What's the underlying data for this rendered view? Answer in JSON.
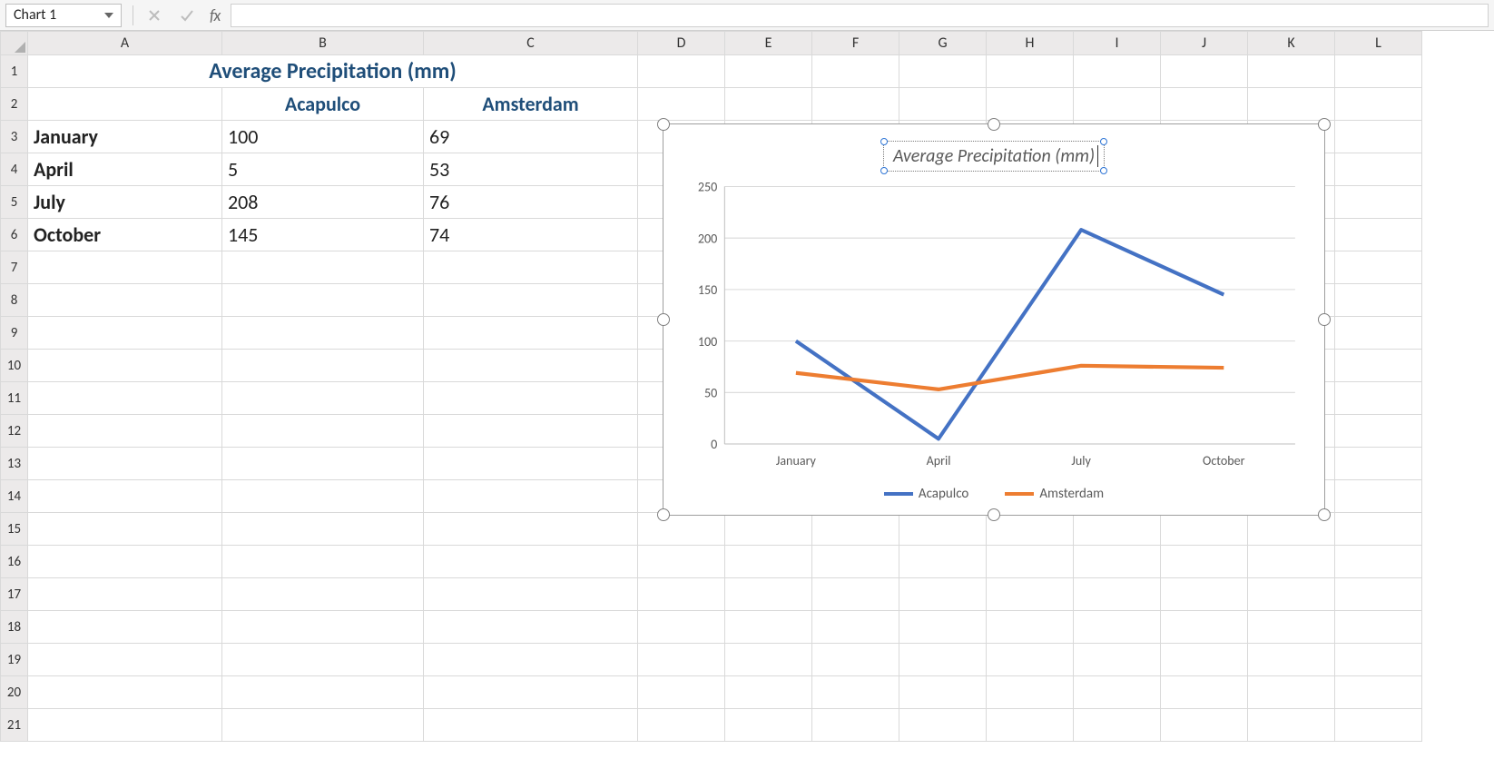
{
  "name_box": {
    "value": "Chart 1"
  },
  "formula_bar": {
    "fx_label": "fx",
    "value": ""
  },
  "columns": [
    "A",
    "B",
    "C",
    "D",
    "E",
    "F",
    "G",
    "H",
    "I",
    "J",
    "K",
    "L"
  ],
  "rows": [
    "1",
    "2",
    "3",
    "4",
    "5",
    "6",
    "7",
    "8",
    "9",
    "10",
    "11",
    "12",
    "13",
    "14",
    "15",
    "16",
    "17",
    "18",
    "19",
    "20",
    "21"
  ],
  "table": {
    "title": "Average Precipitation (mm)",
    "headers": {
      "b": "Acapulco",
      "c": "Amsterdam"
    },
    "data": [
      {
        "month": "January",
        "b": "100",
        "c": "69"
      },
      {
        "month": "April",
        "b": "5",
        "c": "53"
      },
      {
        "month": "July",
        "b": "208",
        "c": "76"
      },
      {
        "month": "October",
        "b": "145",
        "c": "74"
      }
    ]
  },
  "chart": {
    "title": "Average Precipitation (mm)",
    "y_ticks": [
      "0",
      "50",
      "100",
      "150",
      "200",
      "250"
    ],
    "x_ticks": [
      "January",
      "April",
      "July",
      "October"
    ],
    "legend": {
      "s1": "Acapulco",
      "s2": "Amsterdam"
    },
    "colors": {
      "s1": "#4472c4",
      "s2": "#ed7d31",
      "grid": "#d9d9d9",
      "text": "#595959"
    }
  },
  "chart_data": {
    "type": "line",
    "title": "Average Precipitation (mm)",
    "categories": [
      "January",
      "April",
      "July",
      "October"
    ],
    "series": [
      {
        "name": "Acapulco",
        "values": [
          100,
          5,
          208,
          145
        ]
      },
      {
        "name": "Amsterdam",
        "values": [
          69,
          53,
          76,
          74
        ]
      }
    ],
    "ylim": [
      0,
      250
    ],
    "xlabel": "",
    "ylabel": ""
  }
}
